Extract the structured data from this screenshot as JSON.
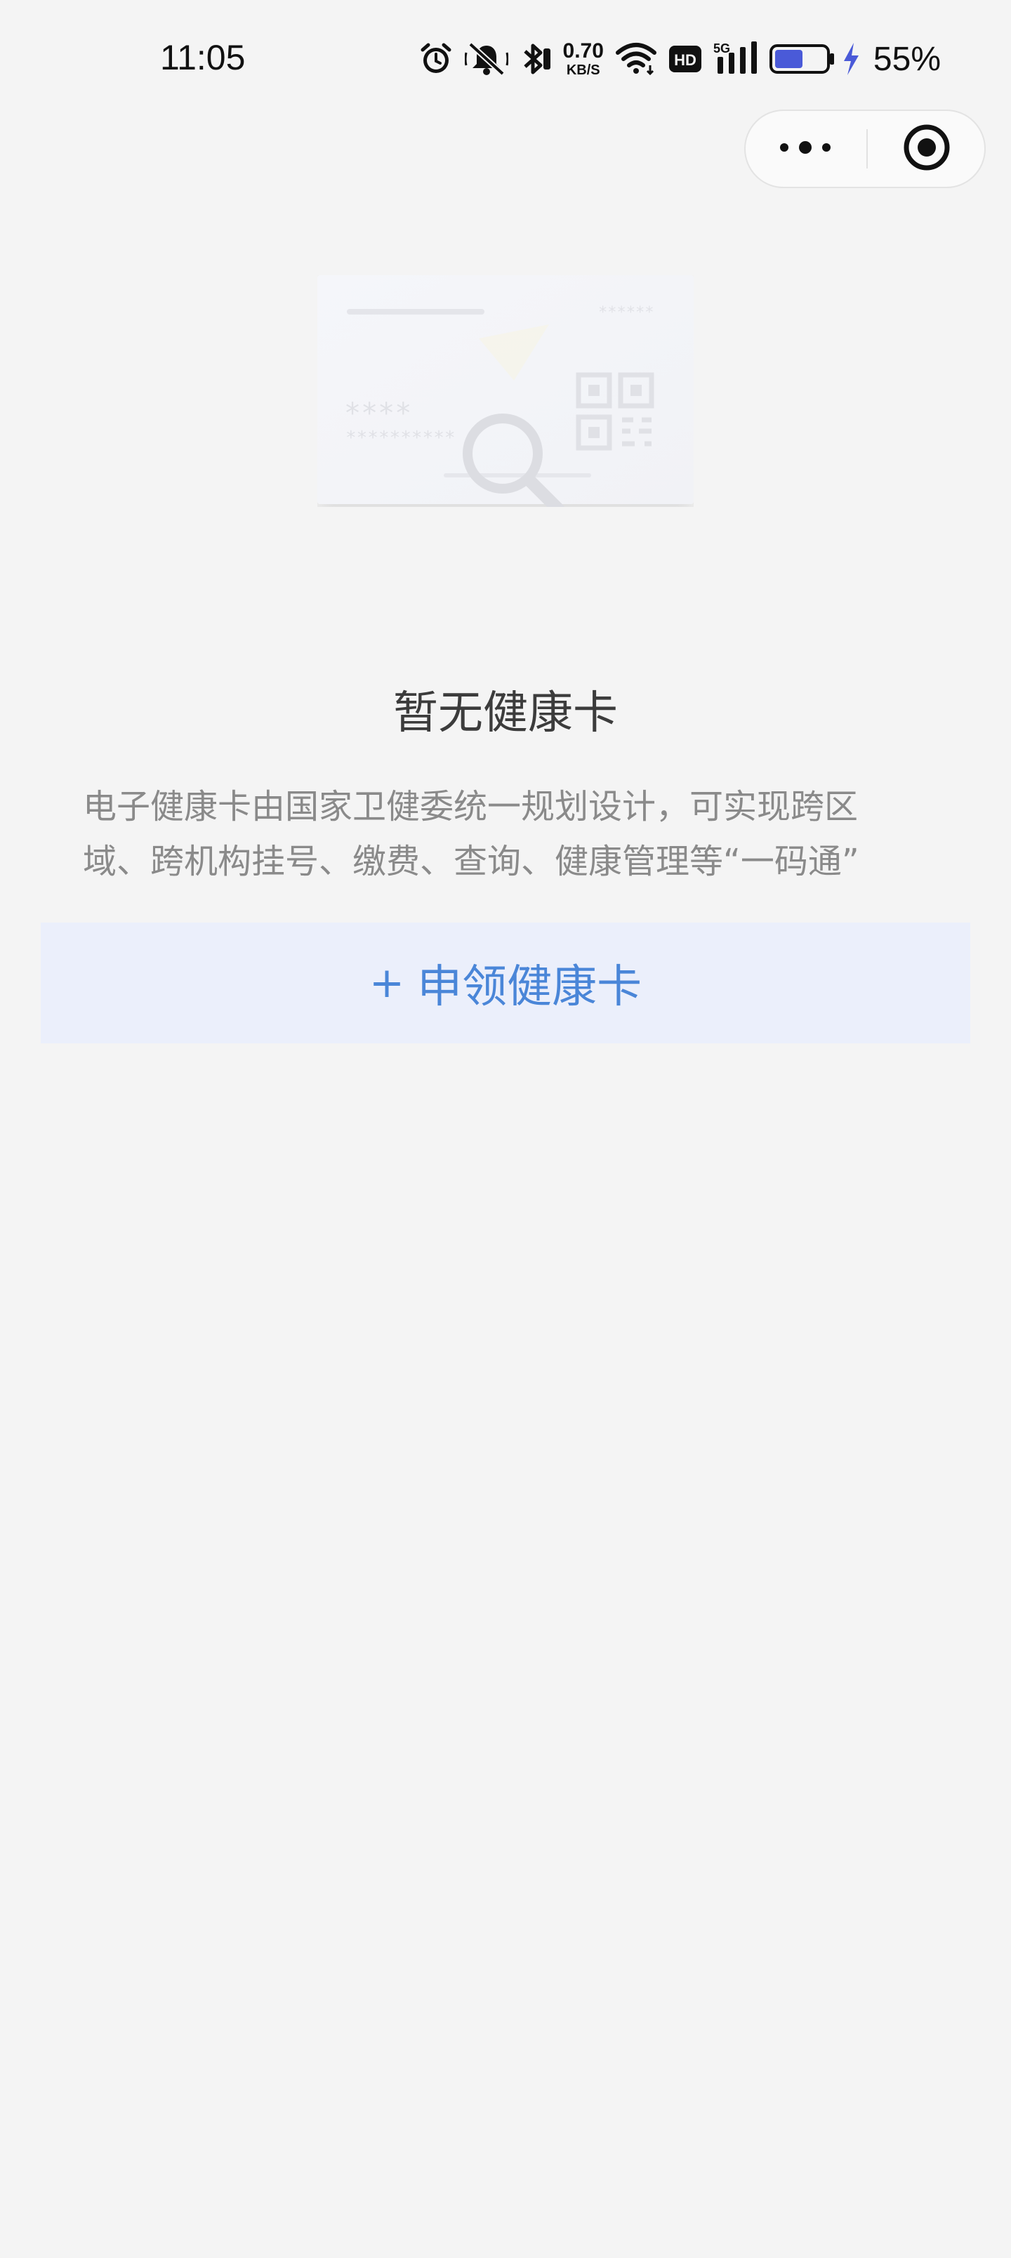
{
  "status_bar": {
    "time": "11:05",
    "net_speed_value": "0.70",
    "net_speed_unit": "KB/S",
    "hd_label": "HD",
    "network_label": "5G",
    "battery_percent": "55%",
    "battery_level": 0.55,
    "icons": [
      "alarm-icon",
      "mute-icon",
      "bluetooth-icon",
      "wifi-icon",
      "hd-icon",
      "signal-icon",
      "battery-icon",
      "charging-icon"
    ]
  },
  "capsule": {
    "more_icon": "more-dots-icon",
    "close_icon": "target-icon"
  },
  "illustration": {
    "masked_name": "****",
    "masked_id": "**********",
    "masked_top": "******"
  },
  "empty_state": {
    "title": "暂无健康卡",
    "description": "电子健康卡由国家卫健委统一规划设计，可实现跨区\n域、跨机构挂号、缴费、查询、健康管理等“一码通”"
  },
  "apply_button": {
    "plus": "+",
    "label": "申领健康卡"
  },
  "colors": {
    "background": "#f4f4f4",
    "accent": "#4a86d8",
    "button_bg": "#ebeffb",
    "battery_fill": "#4a5ad8",
    "charging": "#4a5ad8"
  }
}
